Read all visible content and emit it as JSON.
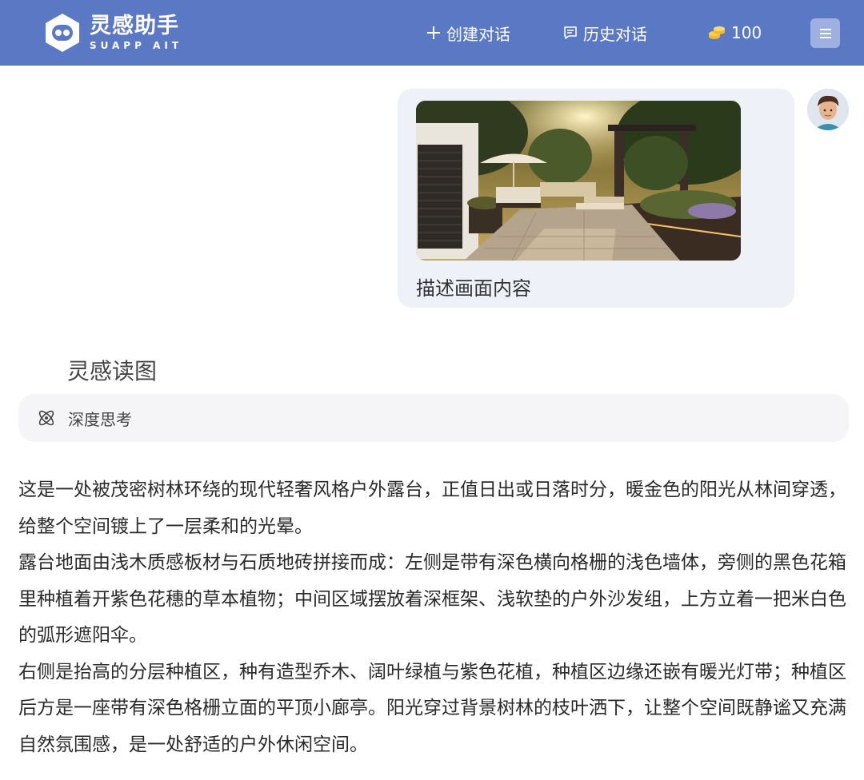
{
  "header": {
    "logo_title": "灵感助手",
    "logo_sub": "SUAPP AIT",
    "new_chat_label": "创建对话",
    "history_label": "历史对话",
    "coins": "100",
    "colors": {
      "bar": "#5b78c4",
      "menu_button": "#9fb0e0"
    }
  },
  "user_message": {
    "text": "描述画面内容",
    "image_icon": "terrace-photo"
  },
  "assistant": {
    "name": "灵感读图",
    "thinking_label": "深度思考",
    "paragraphs": [
      "这是一处被茂密树林环绕的现代轻奢风格户外露台，正值日出或日落时分，暖金色的阳光从林间穿透，给整个空间镀上了一层柔和的光晕。",
      "露台地面由浅木质感板材与石质地砖拼接而成：左侧是带有深色横向格栅的浅色墙体，旁侧的黑色花箱里种植着开紫色花穗的草本植物；中间区域摆放着深框架、浅软垫的户外沙发组，上方立着一把米白色的弧形遮阳伞。",
      "右侧是抬高的分层种植区，种有造型乔木、阔叶绿植与紫色花植，种植区边缘还嵌有暖光灯带；种植区后方是一座带有深色格栅立面的平顶小廊亭。阳光穿过背景树林的枝叶洒下，让整个空间既静谧又充满自然氛围感，是一处舒适的户外休闲空间。"
    ]
  }
}
